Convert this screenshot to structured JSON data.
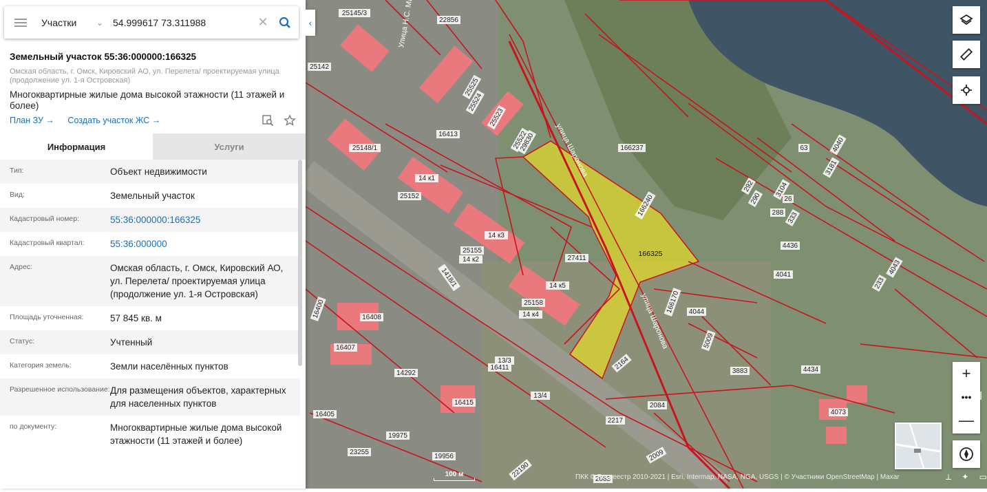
{
  "search": {
    "type": "Участки",
    "value": "54.999617 73.311988"
  },
  "card": {
    "title": "Земельный участок 55:36:000000:166325",
    "address": "Омская область, г. Омск, Кировский АО, ул. Перелета/ проектируемая улица (продолжение ул. 1-я Островская)",
    "description": "Многоквартирные жилые дома высокой этажности (11 этажей и более)",
    "link_plan": "План ЗУ →",
    "link_create": "Создать участок ЖС →"
  },
  "tabs": [
    "Информация",
    "Услуги"
  ],
  "info_rows": [
    {
      "label": "Тип:",
      "value": "Объект недвижимости"
    },
    {
      "label": "Вид:",
      "value": "Земельный участок"
    },
    {
      "label": "Кадастровый номер:",
      "value": "55:36:000000:166325"
    },
    {
      "label": "Кадастровый квартал:",
      "value": "55:36:000000"
    },
    {
      "label": "Адрес:",
      "value": "Омская область, г. Омск, Кировский АО, ул. Перелета/ проектируемая улица (продолжение ул. 1-я Островская)"
    },
    {
      "label": "Площадь уточненная:",
      "value": "57 845 кв. м"
    },
    {
      "label": "Статус:",
      "value": "Учтенный"
    },
    {
      "label": "Категория земель:",
      "value": "Земли населённых пунктов"
    },
    {
      "label": "Разрешенное использование:",
      "value": "Для размещения объектов, характерных для населенных пунктов"
    },
    {
      "label": "по документу:",
      "value": "Многоквартирные жилые дома высокой этажности (11 этажей и более)"
    }
  ],
  "map": {
    "selected_parcel_label": "166325",
    "street_label_1": "улица Шаронова",
    "street_label_2": "улица Шаронова",
    "street_label_3": "Улица Н.С. Махоти",
    "parcel_labels": [
      "29830",
      "25522",
      "166237",
      "166240",
      "27411",
      "166170",
      "4044",
      "5009",
      "2164",
      "3883",
      "4434",
      "2084",
      "2217",
      "2009",
      "2083",
      "4041",
      "4436",
      "25158",
      "25155",
      "25152",
      "25148/1",
      "25145/3",
      "22856",
      "25142",
      "16400",
      "16408",
      "16407",
      "14292",
      "16411",
      "16415",
      "16405",
      "19975",
      "19956",
      "23255",
      "22190",
      "4073",
      "3923",
      "233",
      "4043",
      "288",
      "290",
      "292",
      "3104",
      "63",
      "4040",
      "3181",
      "26",
      "333",
      "1418/1",
      "13/3",
      "13/4",
      "25525",
      "25524",
      "25523",
      "16413",
      "14 к1",
      "14 к2",
      "14 к3",
      "14 к4",
      "14 к5"
    ],
    "scale_label": "100 м",
    "attribution": "ПКК © Росреестр 2010-2021 | Esri, Intermap, NASA, NGA, USGS | © Участники OpenStreetMap | Maxar",
    "selected_fill": "#e6dc28",
    "parcel_line_color": "#c8141e"
  },
  "icons": [
    "menu-icon",
    "chevron-down-icon",
    "clear-icon",
    "search-icon",
    "collapse-icon",
    "zoom-to-icon",
    "star-icon",
    "layers-icon",
    "ruler-icon",
    "locate-icon",
    "zoom-in-icon",
    "more-icon",
    "zoom-out-icon",
    "compass-icon"
  ]
}
